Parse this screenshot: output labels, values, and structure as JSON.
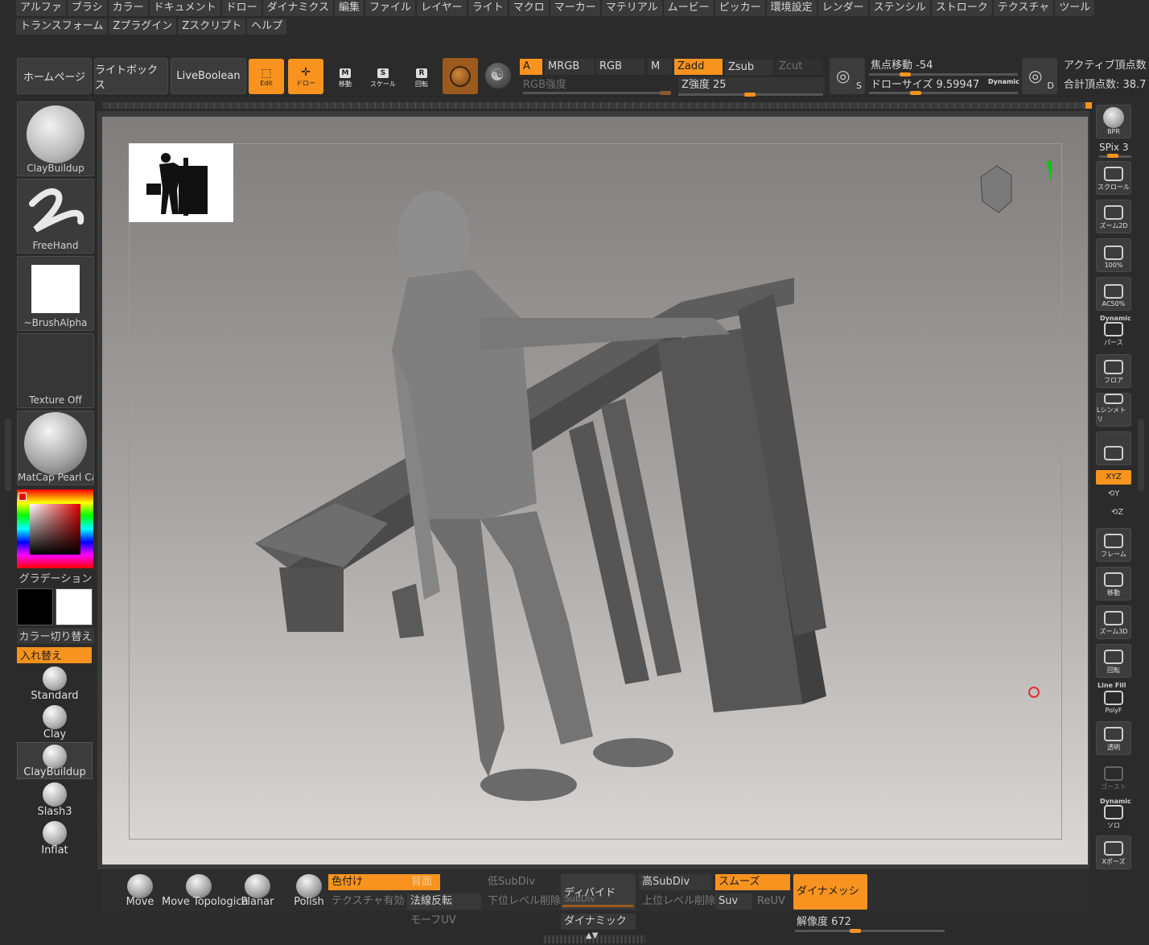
{
  "menu_row1": [
    "アルファ",
    "ブラシ",
    "カラー",
    "ドキュメント",
    "ドロー",
    "ダイナミクス",
    "編集",
    "ファイル",
    "レイヤー",
    "ライト",
    "マクロ",
    "マーカー",
    "マテリアル",
    "ムービー",
    "ピッカー",
    "環境設定",
    "レンダー",
    "ステンシル",
    "ストローク",
    "テクスチャ",
    "ツール"
  ],
  "menu_row2": [
    "トランスフォーム",
    "Zプラグイン",
    "Zスクリプト",
    "ヘルプ"
  ],
  "toolbar": {
    "home": "ホームページ",
    "lightbox": "ライトボックス",
    "liveboolean": "LiveBoolean",
    "edit": "Edit",
    "draw": "ドロー",
    "move": "移動",
    "move_glyph": "M",
    "scale": "スケール",
    "scale_glyph": "S",
    "rotate": "回転",
    "rotate_glyph": "R",
    "a": "A",
    "mrgb": "MRGB",
    "rgb": "RGB",
    "m": "M",
    "zadd": "Zadd",
    "zsub": "Zsub",
    "zcut": "Zcut",
    "rgb_intensity": "RGB強度",
    "z_intensity": "Z強度 25",
    "focal_shift": "焦点移動 -54",
    "draw_size": "ドローサイズ 9.59947",
    "dynamic": "Dynamic",
    "s_label": "S",
    "d_label": "D",
    "active_points": "アクティブ頂点数",
    "total_points": "合計頂点数: 38.7"
  },
  "left_panel": {
    "brush_name": "ClayBuildup",
    "stroke_name": "FreeHand",
    "alpha_name": "~BrushAlpha",
    "texture_name": "Texture Off",
    "material_name": "MatCap Pearl Ca",
    "gradient": "グラデーション",
    "switch_color": "カラー切り替え",
    "swap": "入れ替え",
    "brushes": [
      "Standard",
      "Clay",
      "ClayBuildup",
      "Slash3",
      "Inflat"
    ]
  },
  "right_shelf": {
    "bpr": "BPR",
    "spix": "SPix 3",
    "buttons": [
      "スクロール",
      "ズーム2D",
      "100%",
      "AC50%",
      "パース",
      "フロア",
      "Lシンメトリ",
      "",
      "XYZ",
      "",
      "",
      "フレーム",
      "移動",
      "ズーム3D",
      "回転",
      "PolyF",
      "透明",
      "ゴースト",
      "ソロ",
      "Xポーズ"
    ],
    "dynamic_top": "Dynamic",
    "line_fill": "Line Fill",
    "dynamic_solo": "Dynamic",
    "y_label": "Y",
    "z_label": "Z"
  },
  "bottom": {
    "brush_icons": [
      "Move",
      "Move Topologica",
      "Planar",
      "Polish"
    ],
    "colorize": "色付け",
    "backface": "背面",
    "texture_on": "テクスチャ有効",
    "flip_normals": "法線反転",
    "morph_uv": "モーフUV",
    "lower_subdiv": "低SubDiv",
    "del_lower": "下位レベル削除",
    "divide": "ディバイド",
    "subdiv": "SubDiv",
    "dynamic_btn": "ダイナミック",
    "higher_subdiv": "高SubDiv",
    "del_higher": "上位レベル削除",
    "smooth": "スムーズ",
    "suv": "Suv",
    "reuv": "ReUV",
    "dynamesh": "ダイナメッシュ",
    "resolution": "解像度 672"
  },
  "colors": {
    "accent": "#f7931e",
    "bg": "#2b2b2b",
    "panel": "#3b3b3b"
  }
}
